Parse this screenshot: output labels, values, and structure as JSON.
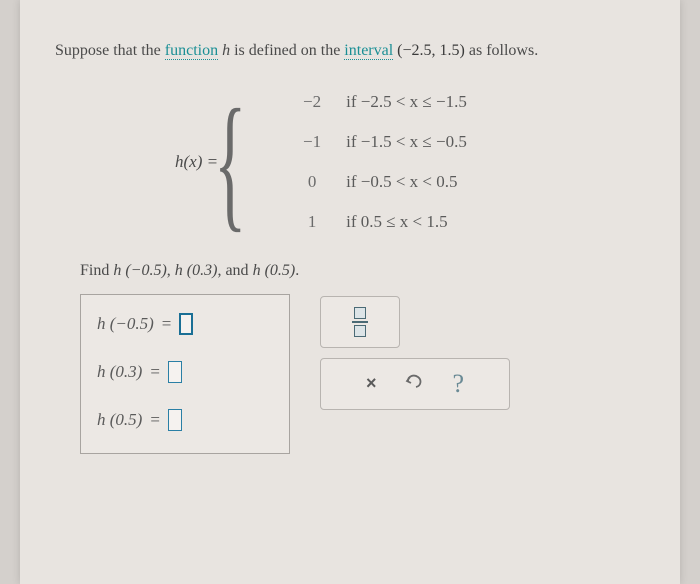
{
  "intro": {
    "prefix": "Suppose that the ",
    "term_function": "function",
    "mid1": " ",
    "hvar": "h",
    "mid2": " is defined on the ",
    "term_interval": "interval",
    "mid3": " ",
    "interval_text": "(−2.5,  1.5)",
    "suffix": " as follows."
  },
  "piecewise": {
    "label_h": "h",
    "label_x": "(x) =",
    "rows": [
      {
        "val": "−2",
        "cond": "if −2.5 < x ≤ −1.5"
      },
      {
        "val": "−1",
        "cond": "if −1.5 < x ≤ −0.5"
      },
      {
        "val": "0",
        "cond": "if −0.5 < x < 0.5"
      },
      {
        "val": "1",
        "cond": "if 0.5 ≤ x < 1.5"
      }
    ]
  },
  "find": {
    "prefix": "Find ",
    "a": "h (−0.5)",
    "sep1": ", ",
    "b": "h (0.3)",
    "sep2": ", and ",
    "c": "h (0.5)",
    "suffix": "."
  },
  "answers": {
    "eq": "=",
    "rows": [
      {
        "label": "h (−0.5)",
        "value": "",
        "active": true
      },
      {
        "label": "h (0.3)",
        "value": "",
        "active": false
      },
      {
        "label": "h (0.5)",
        "value": "",
        "active": false
      }
    ]
  },
  "tools": {
    "clear": "×",
    "help": "?"
  }
}
